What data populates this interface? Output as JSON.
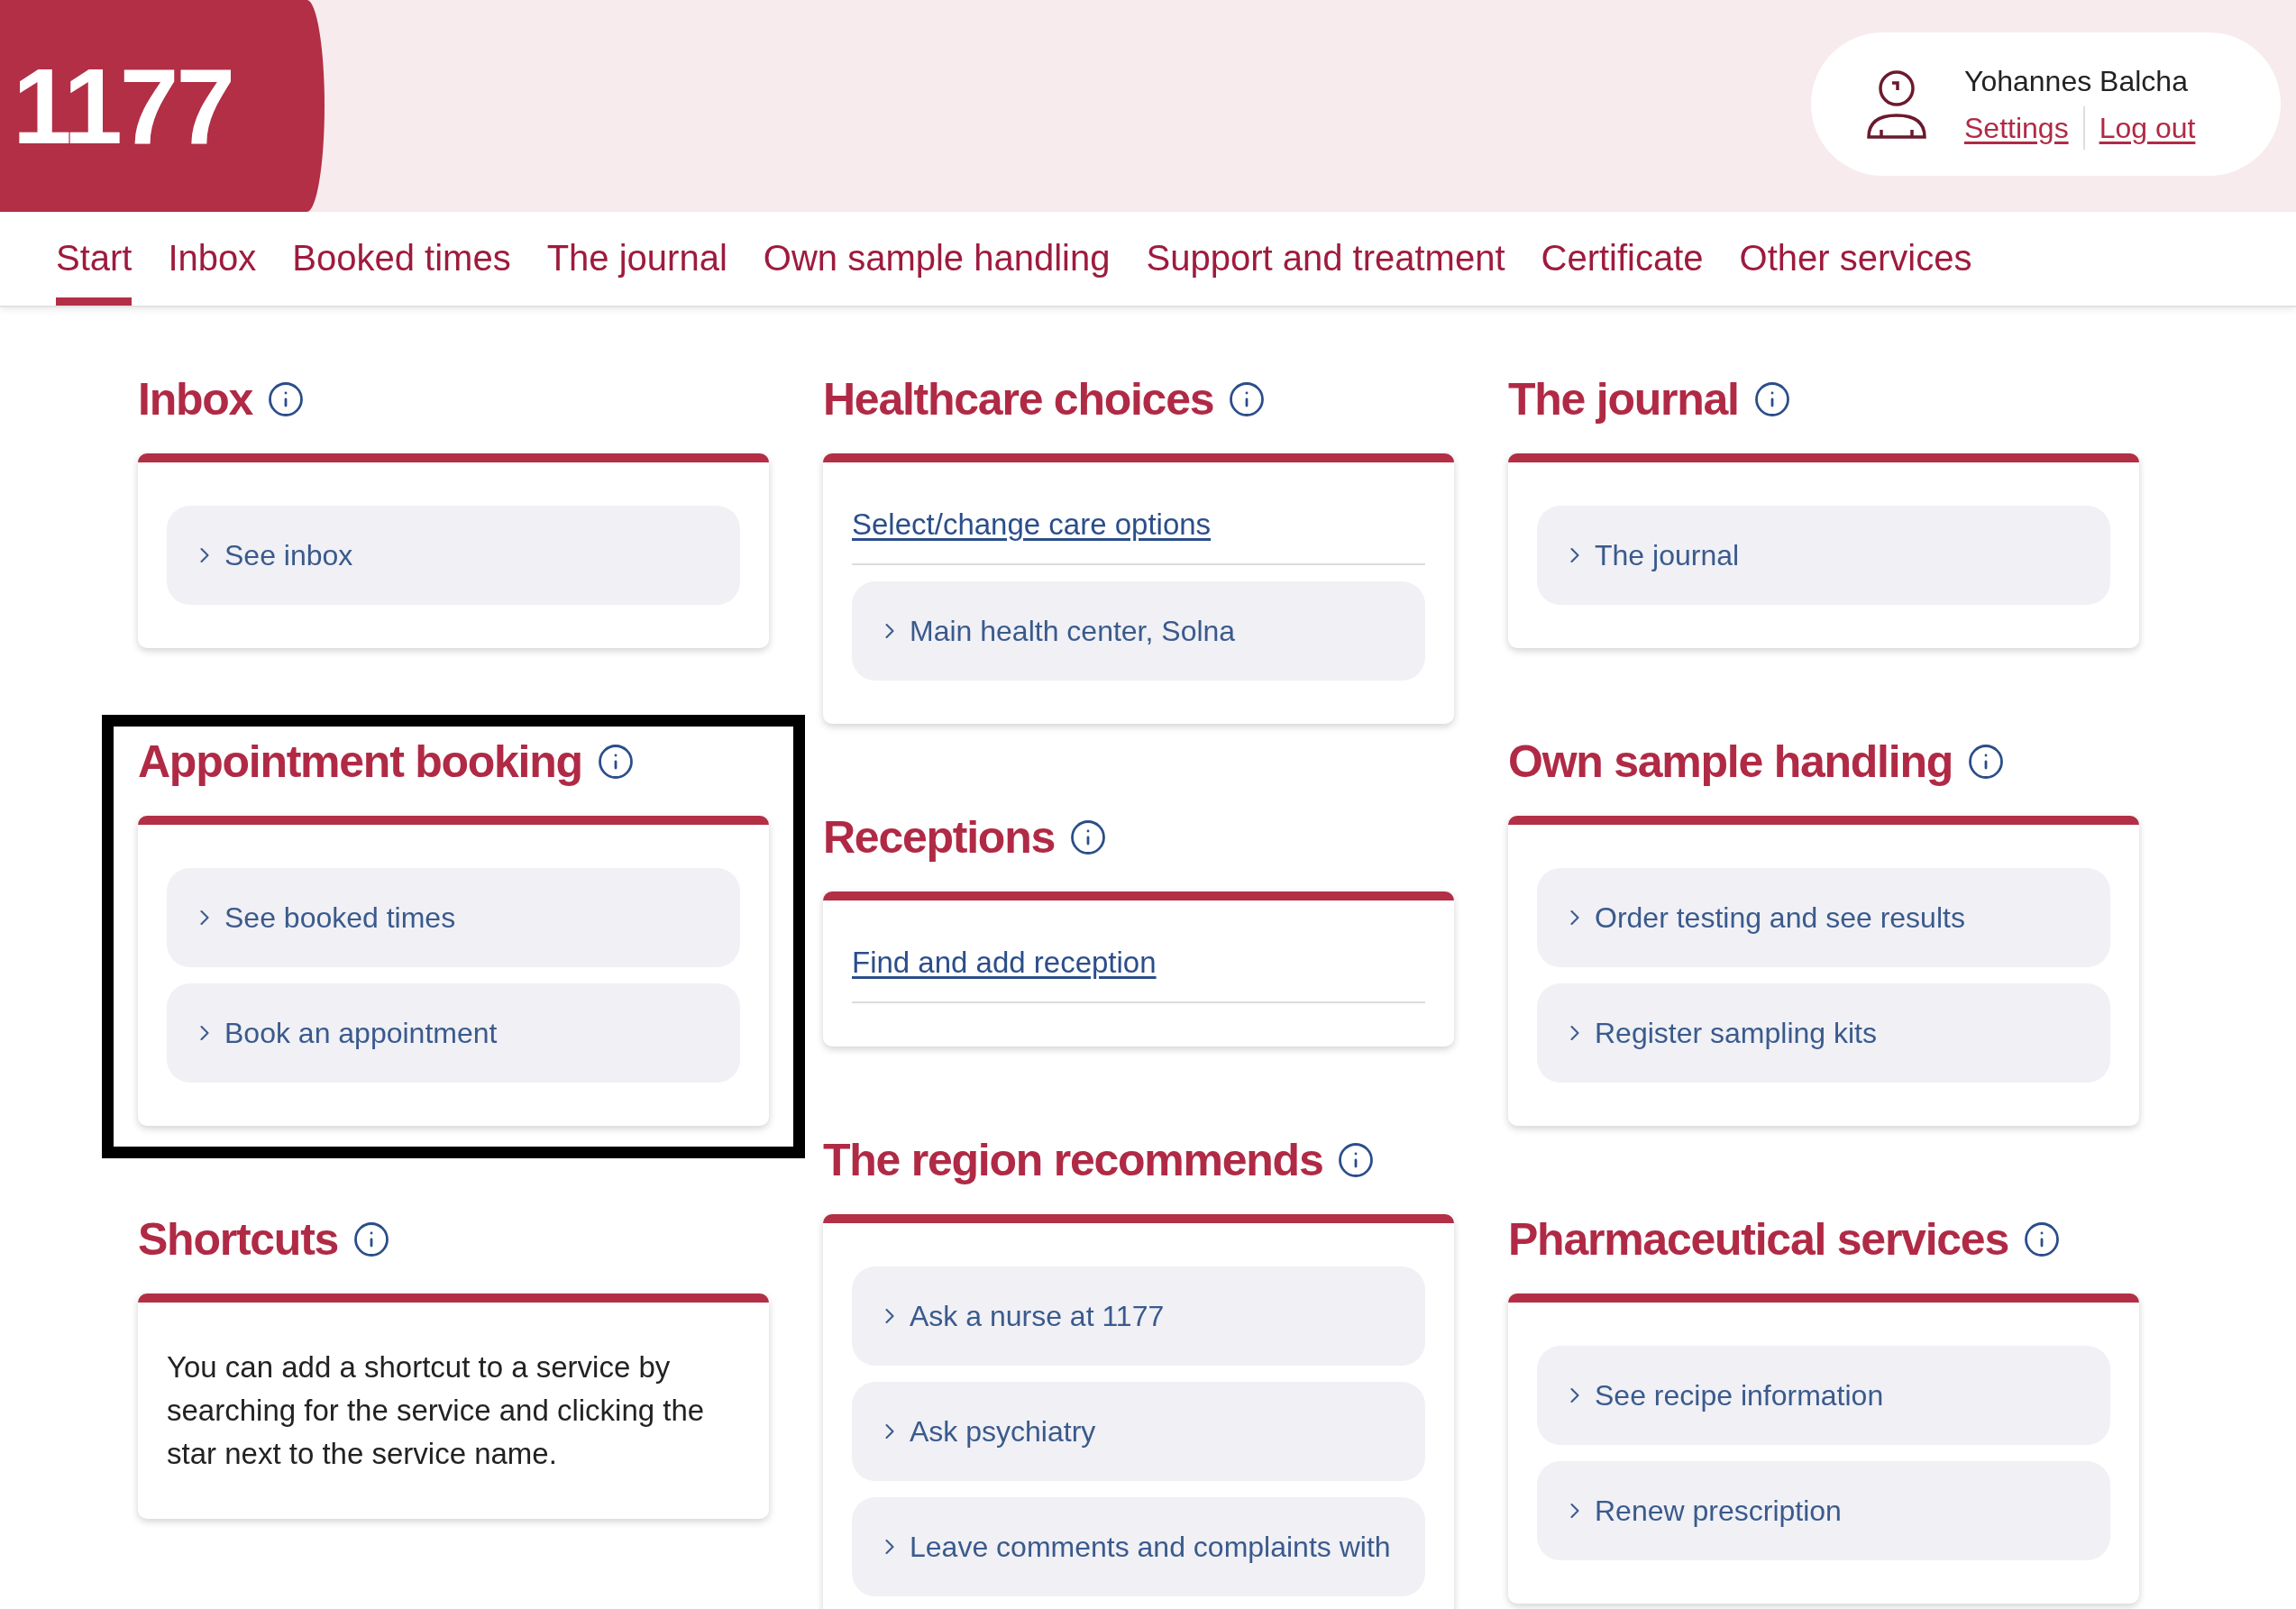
{
  "logo": "1177",
  "user": {
    "name": "Yohannes Balcha",
    "links": [
      "Settings",
      "Log out"
    ]
  },
  "tabs": [
    {
      "label": "Start",
      "selected": true
    },
    {
      "label": "Inbox",
      "selected": false
    },
    {
      "label": "Booked times",
      "selected": false
    },
    {
      "label": "The journal",
      "selected": false
    },
    {
      "label": "Own sample handling",
      "selected": false
    },
    {
      "label": "Support and treatment",
      "selected": false
    },
    {
      "label": "Certificate",
      "selected": false
    },
    {
      "label": "Other services",
      "selected": false
    }
  ],
  "columns": [
    [
      {
        "title": "Inbox",
        "highlighted": false,
        "entries": [
          {
            "kind": "item",
            "text": "See inbox"
          }
        ]
      },
      {
        "title": "Appointment booking",
        "highlighted": true,
        "entries": [
          {
            "kind": "item",
            "text": "See booked times"
          },
          {
            "kind": "item",
            "text": "Book an appointment"
          }
        ]
      },
      {
        "title": "Shortcuts",
        "highlighted": false,
        "entries": [
          {
            "kind": "text",
            "text": "You can add a shortcut to a service by searching for the service and clicking the star next to the service name."
          }
        ]
      }
    ],
    [
      {
        "title": "Healthcare choices",
        "highlighted": false,
        "entries": [
          {
            "kind": "link",
            "text": "Select/change care options"
          },
          {
            "kind": "item",
            "text": "Main health center, Solna"
          }
        ]
      },
      {
        "title": "Receptions",
        "highlighted": false,
        "entries": [
          {
            "kind": "link",
            "text": "Find and add reception"
          }
        ]
      },
      {
        "title": "The region recommends",
        "highlighted": false,
        "entries": [
          {
            "kind": "item",
            "text": "Ask a nurse at 1177"
          },
          {
            "kind": "item",
            "text": "Ask psychiatry"
          },
          {
            "kind": "item",
            "text": "Leave comments and complaints with"
          }
        ]
      }
    ],
    [
      {
        "title": "The journal",
        "highlighted": false,
        "entries": [
          {
            "kind": "item",
            "text": "The journal"
          }
        ]
      },
      {
        "title": "Own sample handling",
        "highlighted": false,
        "entries": [
          {
            "kind": "item",
            "text": "Order testing and see results"
          },
          {
            "kind": "item",
            "text": "Register sampling kits"
          }
        ]
      },
      {
        "title": "Pharmaceutical services",
        "highlighted": false,
        "entries": [
          {
            "kind": "item",
            "text": "See recipe information"
          },
          {
            "kind": "item",
            "text": "Renew prescription"
          }
        ]
      }
    ]
  ]
}
